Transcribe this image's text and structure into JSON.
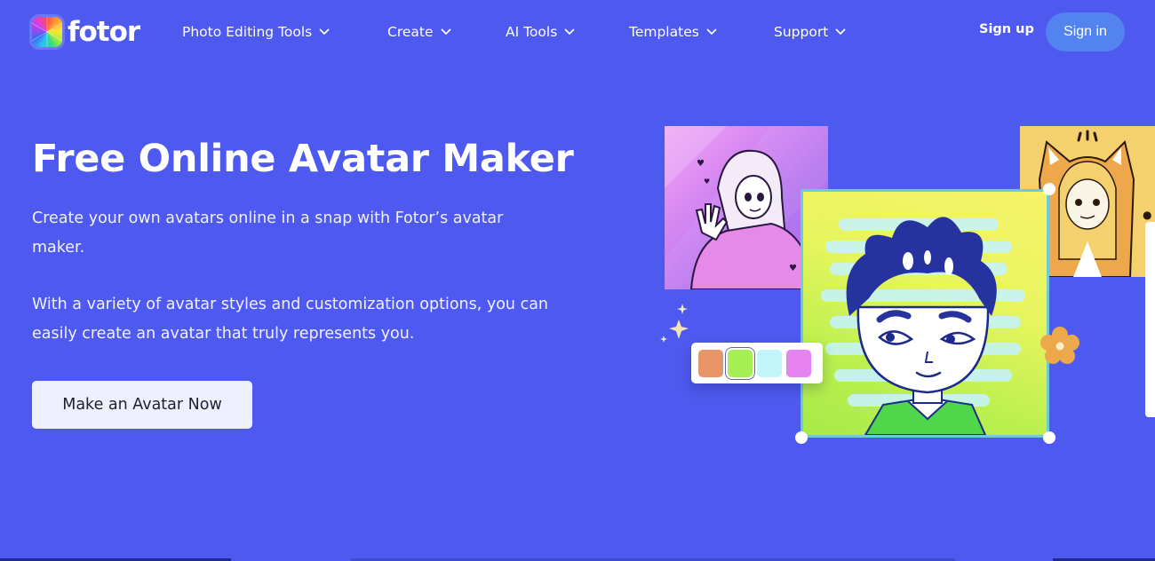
{
  "brand": {
    "name": "fotor",
    "logo_icon": "fotor-aperture-logo-icon"
  },
  "nav": {
    "items": [
      {
        "label": "Photo Editing Tools",
        "icon": "chevron-down-icon"
      },
      {
        "label": "Create",
        "icon": "chevron-down-icon"
      },
      {
        "label": "AI Tools",
        "icon": "chevron-down-icon"
      },
      {
        "label": "Templates",
        "icon": "chevron-down-icon"
      },
      {
        "label": "Support",
        "icon": "chevron-down-icon"
      }
    ],
    "signup_label": "Sign up",
    "signin_label": "Sign in"
  },
  "hero": {
    "title": "Free Online Avatar Maker",
    "paragraph_1": "Create your own avatars online in a snap with Fotor’s avatar maker.",
    "paragraph_2": "With a variety of avatar styles and customization options, you can easily create an avatar that truly represents you.",
    "cta_label": "Make an Avatar Now"
  },
  "illustration": {
    "cards": [
      {
        "name": "waving-girl-avatar"
      },
      {
        "name": "fox-hood-girl-avatar"
      },
      {
        "name": "blue-hair-boy-avatar",
        "selected": true
      }
    ],
    "palette": {
      "swatches": [
        {
          "color": "#e9956a",
          "selected": false
        },
        {
          "color": "#a6ef54",
          "selected": true
        },
        {
          "color": "#c3f6f8",
          "selected": false
        },
        {
          "color": "#e683f0",
          "selected": false
        }
      ]
    }
  },
  "colors": {
    "background": "#4e59ef",
    "signin_button": "#5383ef",
    "cta_button": "#eef0fd"
  }
}
